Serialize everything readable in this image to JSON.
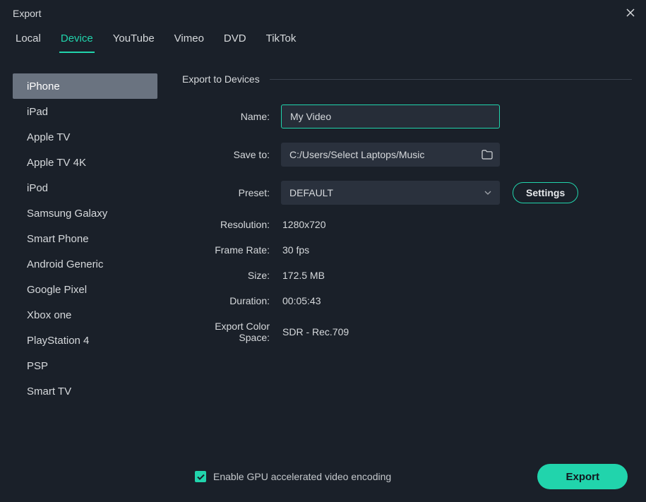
{
  "window": {
    "title": "Export"
  },
  "tabs": [
    {
      "label": "Local"
    },
    {
      "label": "Device"
    },
    {
      "label": "YouTube"
    },
    {
      "label": "Vimeo"
    },
    {
      "label": "DVD"
    },
    {
      "label": "TikTok"
    }
  ],
  "active_tab_index": 1,
  "sidebar": {
    "items": [
      "iPhone",
      "iPad",
      "Apple TV",
      "Apple TV 4K",
      "iPod",
      "Samsung Galaxy",
      "Smart Phone",
      "Android Generic",
      "Google Pixel",
      "Xbox one",
      "PlayStation 4",
      "PSP",
      "Smart TV"
    ],
    "selected_index": 0
  },
  "section_title": "Export to Devices",
  "form": {
    "name_label": "Name:",
    "name_value": "My Video",
    "saveto_label": "Save to:",
    "saveto_value": "C:/Users/Select Laptops/Music",
    "preset_label": "Preset:",
    "preset_value": "DEFAULT",
    "settings_label": "Settings"
  },
  "info": {
    "resolution_label": "Resolution:",
    "resolution_value": "1280x720",
    "framerate_label": "Frame Rate:",
    "framerate_value": "30 fps",
    "size_label": "Size:",
    "size_value": "172.5 MB",
    "duration_label": "Duration:",
    "duration_value": "00:05:43",
    "colorspace_label": "Export Color Space:",
    "colorspace_value": "SDR - Rec.709"
  },
  "footer": {
    "gpu_checkbox_label": "Enable GPU accelerated video encoding",
    "gpu_checked": true,
    "export_label": "Export"
  },
  "colors": {
    "accent": "#21d4ac",
    "bg": "#1a2029",
    "input_bg": "#2a313d",
    "selected_bg": "#6a7380"
  }
}
